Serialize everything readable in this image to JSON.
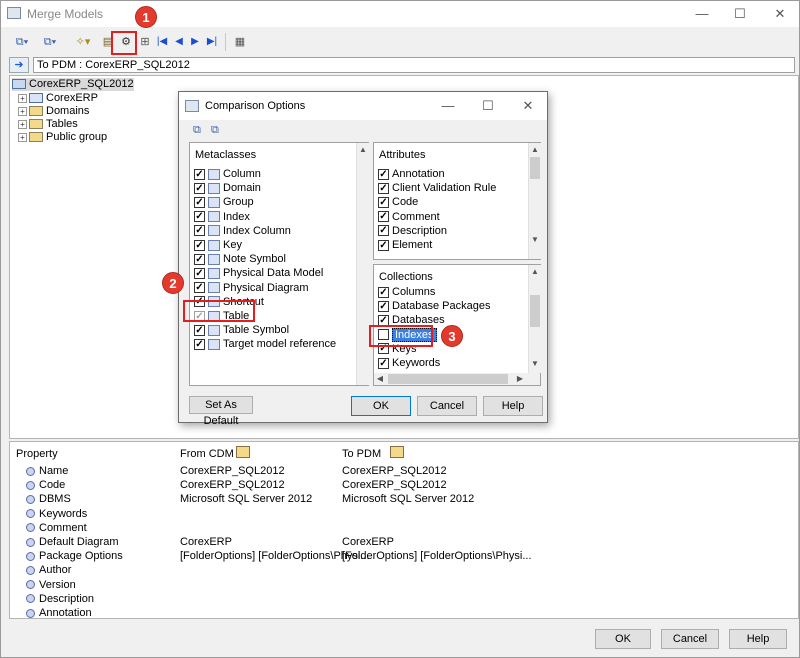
{
  "window": {
    "title": "Merge Models",
    "minimize": "—",
    "maximize": "☐",
    "close": "✕"
  },
  "path": {
    "label": "To PDM : CorexERP_SQL2012"
  },
  "tree": {
    "root": "CorexERP_SQL2012",
    "children": [
      "CorexERP",
      "Domains",
      "Tables",
      "Public group"
    ]
  },
  "properties": {
    "headers": {
      "property": "Property",
      "from": "From CDM",
      "to": "To PDM"
    },
    "rows": [
      {
        "name": "Name",
        "from": "CorexERP_SQL2012",
        "to": "CorexERP_SQL2012"
      },
      {
        "name": "Code",
        "from": "CorexERP_SQL2012",
        "to": "CorexERP_SQL2012"
      },
      {
        "name": "DBMS",
        "from": "Microsoft SQL Server 2012",
        "to": "Microsoft SQL Server 2012"
      },
      {
        "name": "Keywords",
        "from": "",
        "to": ""
      },
      {
        "name": "Comment",
        "from": "",
        "to": ""
      },
      {
        "name": "Default Diagram",
        "from": "CorexERP",
        "to": "CorexERP"
      },
      {
        "name": "Package Options",
        "from": "[FolderOptions]  [FolderOptions\\Physi...",
        "to": "[FolderOptions]  [FolderOptions\\Physi..."
      },
      {
        "name": "Author",
        "from": "",
        "to": ""
      },
      {
        "name": "Version",
        "from": "",
        "to": ""
      },
      {
        "name": "Description",
        "from": "",
        "to": ""
      },
      {
        "name": "Annotation",
        "from": "",
        "to": ""
      }
    ]
  },
  "buttons": {
    "ok": "OK",
    "cancel": "Cancel",
    "help": "Help"
  },
  "dialog": {
    "title": "Comparison Options",
    "metaclasses_header": "Metaclasses",
    "metaclasses": [
      {
        "label": "Column",
        "checked": true
      },
      {
        "label": "Domain",
        "checked": true
      },
      {
        "label": "Group",
        "checked": true
      },
      {
        "label": "Index",
        "checked": true
      },
      {
        "label": "Index Column",
        "checked": true
      },
      {
        "label": "Key",
        "checked": true
      },
      {
        "label": "Note Symbol",
        "checked": true
      },
      {
        "label": "Physical Data Model",
        "checked": true
      },
      {
        "label": "Physical Diagram",
        "checked": true
      },
      {
        "label": "Shortcut",
        "checked": true
      },
      {
        "label": "Table",
        "checked": true
      },
      {
        "label": "Table Symbol",
        "checked": true
      },
      {
        "label": "Target model reference",
        "checked": true
      }
    ],
    "attributes_header": "Attributes",
    "attributes": [
      "Annotation",
      "Client Validation Rule",
      "Code",
      "Comment",
      "Description",
      "Element"
    ],
    "collections_header": "Collections",
    "collections": [
      {
        "label": "Columns",
        "checked": true
      },
      {
        "label": "Database Packages",
        "checked": true
      },
      {
        "label": "Databases",
        "checked": true
      },
      {
        "label": "Indexes",
        "checked": false
      },
      {
        "label": "Keys",
        "checked": true
      },
      {
        "label": "Keywords",
        "checked": true
      }
    ],
    "set_default": "Set As Default",
    "ok": "OK",
    "cancel": "Cancel",
    "help": "Help"
  },
  "callouts": [
    "1",
    "2",
    "3"
  ],
  "colors": {
    "callout": "#e23b2e",
    "highlight": "#3b7fe0"
  }
}
